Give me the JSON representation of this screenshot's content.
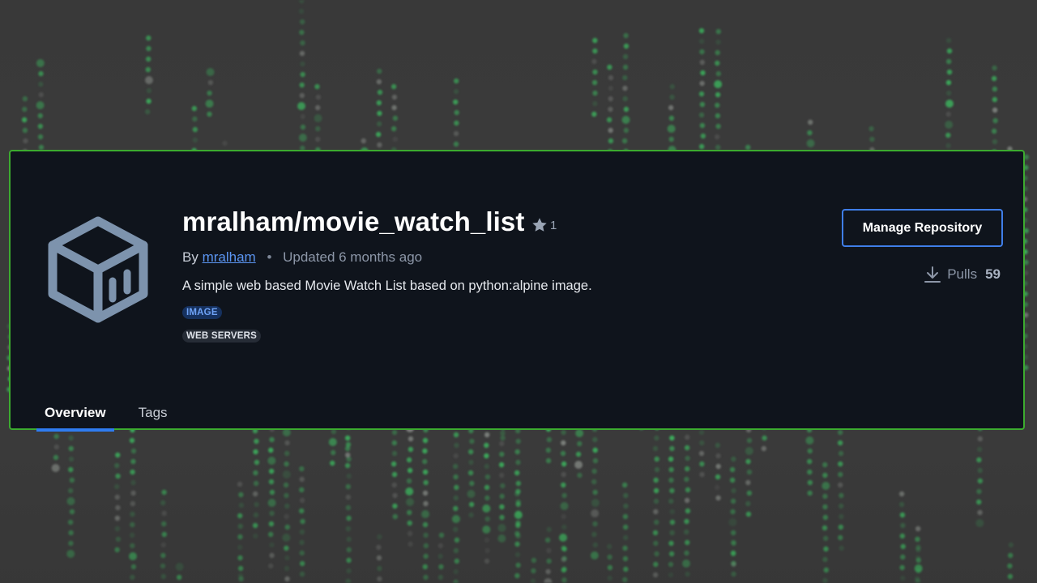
{
  "repository": {
    "title": "mralham/movie_watch_list",
    "star_count": "1",
    "by_prefix": "By",
    "author": "mralham",
    "separator": "•",
    "updated": "Updated 6 months ago",
    "description": "A simple web based Movie Watch List based on python:alpine image.",
    "badges": [
      {
        "label": "IMAGE"
      },
      {
        "label": "WEB SERVERS"
      }
    ],
    "icon": "repository-box-icon"
  },
  "actions": {
    "manage_label": "Manage Repository",
    "pulls_label": "Pulls",
    "pulls_count": "59",
    "pulls_icon": "download-icon"
  },
  "tabs": [
    {
      "label": "Overview",
      "active": true
    },
    {
      "label": "Tags",
      "active": false
    }
  ],
  "colors": {
    "card_border": "#3cab2f",
    "card_bg": "#0f141c",
    "accent": "#3f7ee8",
    "link": "#5b95f2",
    "matrix_green": "#3ddc6a"
  }
}
